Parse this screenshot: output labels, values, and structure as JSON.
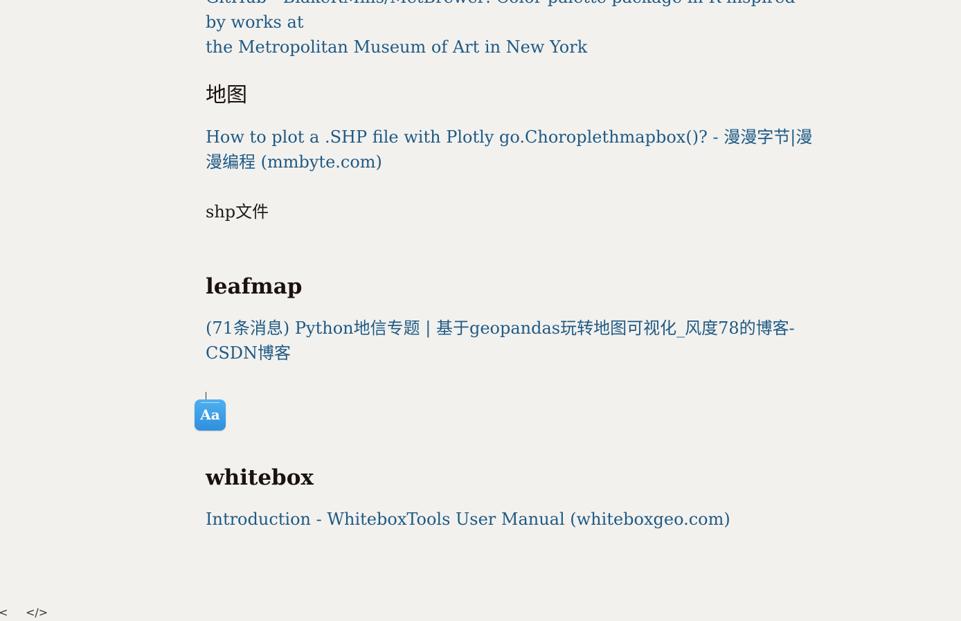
{
  "top_link": {
    "line1": "GitHub - BlakeRMills/MetBrewer: Color palette package in R inspired by works at",
    "line2": "the Metropolitan Museum of Art in New York"
  },
  "sections": {
    "map": {
      "heading": "地图",
      "link": "How to plot a .SHP file with Plotly go.Choroplethmapbox()? - 漫漫字节|漫漫编程 (mmbyte.com)",
      "note": "shp文件"
    },
    "leafmap": {
      "heading": "leafmap",
      "link": "(71条消息) Python地信专题 | 基于geopandas玩转地图可视化_风度78的博客-CSDN博客"
    },
    "whitebox": {
      "heading": "whitebox",
      "link": "Introduction - WhiteboxTools User Manual (whiteboxgeo.com)"
    }
  },
  "format_badge": {
    "label": "Aa",
    "icon": "text-format-icon",
    "color": "#3a9de6"
  },
  "bottom_bar": {
    "back_glyph": "<",
    "source_glyph": "</>"
  },
  "colors": {
    "background": "#f3f1ee",
    "link": "#1e5a85",
    "heading": "#1a1210"
  }
}
